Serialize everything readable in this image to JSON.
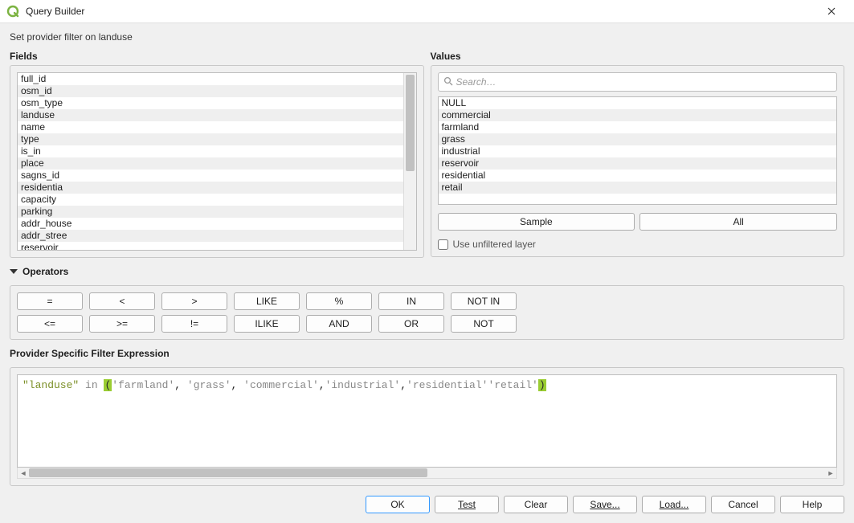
{
  "window": {
    "title": "Query Builder",
    "subhead": "Set provider filter on landuse"
  },
  "fields": {
    "label": "Fields",
    "items": [
      "full_id",
      "osm_id",
      "osm_type",
      "landuse",
      "name",
      "type",
      "is_in",
      "place",
      "sagns_id",
      "residentia",
      "capacity",
      "parking",
      "addr_house",
      "addr_stree",
      "reservoir"
    ]
  },
  "values": {
    "label": "Values",
    "search_placeholder": "Search…",
    "items": [
      "NULL",
      "commercial",
      "farmland",
      "grass",
      "industrial",
      "reservoir",
      "residential",
      "retail"
    ],
    "sample_label": "Sample",
    "all_label": "All",
    "unfiltered_label": "Use unfiltered layer",
    "unfiltered_checked": false
  },
  "operators": {
    "label": "Operators",
    "row1": [
      "=",
      "<",
      ">",
      "LIKE",
      "%",
      "IN",
      "NOT IN"
    ],
    "row2": [
      "<=",
      ">=",
      "!=",
      "ILIKE",
      "AND",
      "OR",
      "NOT"
    ]
  },
  "expression": {
    "label": "Provider Specific Filter Expression",
    "tokens": {
      "field": "\"landuse\"",
      "kw": "in",
      "open": "(",
      "s1": "'farmland'",
      "c": ",",
      "sp": " ",
      "s2": "'grass'",
      "s3": "'commercial'",
      "s4": "'industrial'",
      "s5": "'residential'",
      "s6": "'retail'",
      "close": ")"
    }
  },
  "footer": {
    "ok": "OK",
    "test": "Test",
    "clear": "Clear",
    "save": "Save...",
    "load": "Load...",
    "cancel": "Cancel",
    "help": "Help"
  }
}
